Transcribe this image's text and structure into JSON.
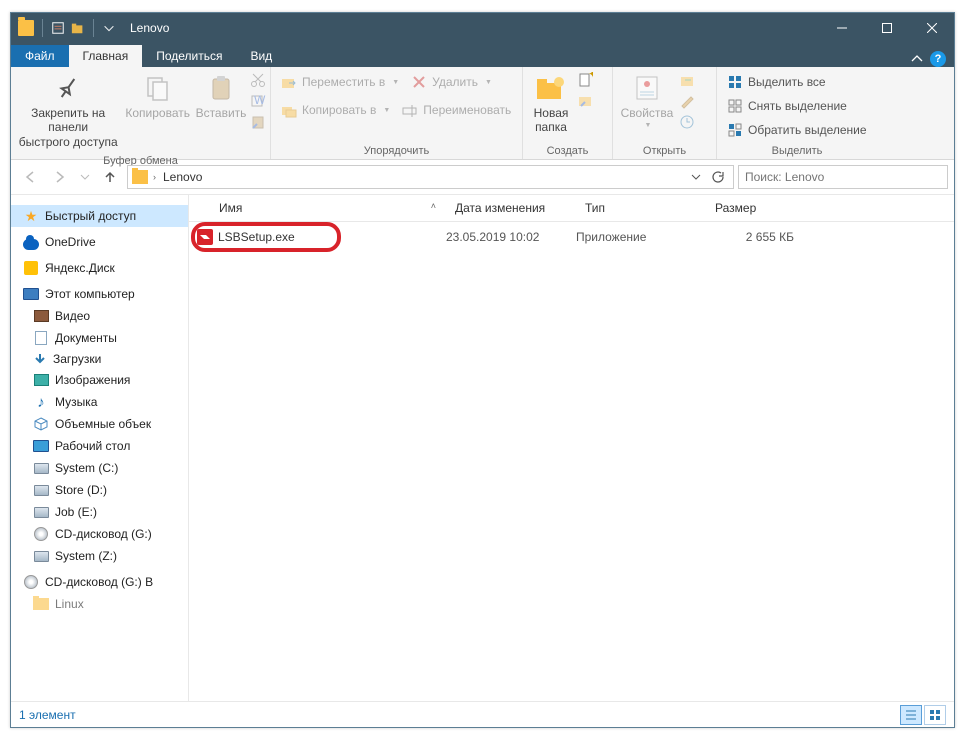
{
  "titlebar": {
    "title": "Lenovo"
  },
  "tabs": {
    "file": "Файл",
    "home": "Главная",
    "share": "Поделиться",
    "view": "Вид"
  },
  "ribbon": {
    "clipboard": {
      "pin": "Закрепить на панели\nбыстрого доступа",
      "copy": "Копировать",
      "paste": "Вставить",
      "label": "Буфер обмена"
    },
    "organize": {
      "moveto": "Переместить в",
      "copyto": "Копировать в",
      "delete": "Удалить",
      "rename": "Переименовать",
      "label": "Упорядочить"
    },
    "new": {
      "folder": "Новая\nпапка",
      "label": "Создать"
    },
    "open": {
      "properties": "Свойства",
      "label": "Открыть"
    },
    "select": {
      "all": "Выделить все",
      "none": "Снять выделение",
      "invert": "Обратить выделение",
      "label": "Выделить"
    }
  },
  "address": {
    "crumb": "Lenovo"
  },
  "search": {
    "placeholder": "Поиск: Lenovo"
  },
  "sidebar": {
    "quick": "Быстрый доступ",
    "onedrive": "OneDrive",
    "yandex": "Яндекс.Диск",
    "thispc": "Этот компьютер",
    "video": "Видео",
    "documents": "Документы",
    "downloads": "Загрузки",
    "pictures": "Изображения",
    "music": "Музыка",
    "volumes": "Объемные объек",
    "desktop": "Рабочий стол",
    "sysC": "System (C:)",
    "storeD": "Store (D:)",
    "jobE": "Job (E:)",
    "cdG": "CD-дисковод (G:)",
    "sysZ": "System (Z:)",
    "cdGB": "CD-дисковод (G:) B",
    "linux": "Linux"
  },
  "columns": {
    "name": "Имя",
    "date": "Дата изменения",
    "type": "Тип",
    "size": "Размер"
  },
  "files": [
    {
      "name": "LSBSetup.exe",
      "date": "23.05.2019 10:02",
      "type": "Приложение",
      "size": "2 655 КБ"
    }
  ],
  "status": {
    "count": "1 элемент"
  }
}
